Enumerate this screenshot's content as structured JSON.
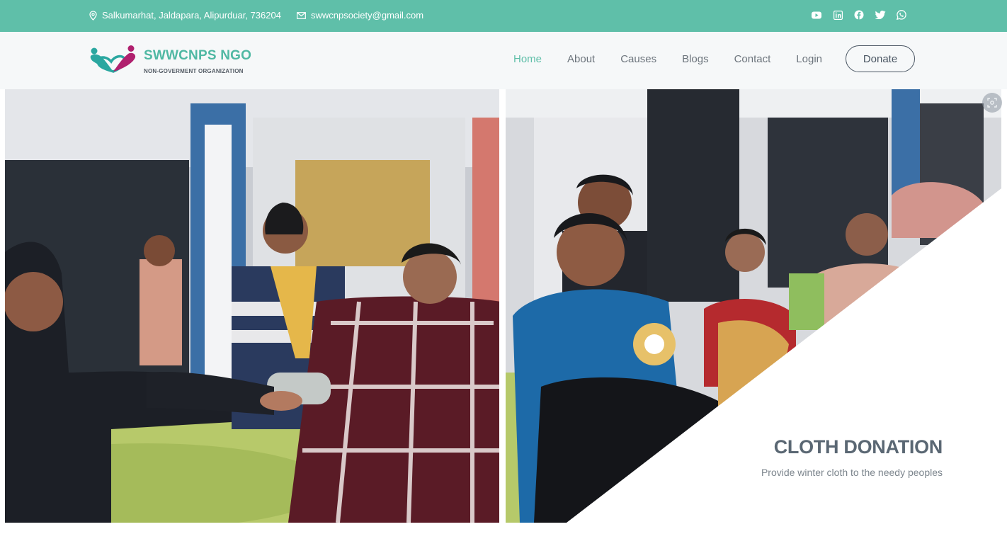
{
  "topbar": {
    "address": "Salkumarhat, Jaldapara, Alipurduar, 736204",
    "email": "swwcnpsociety@gmail.com",
    "social_icons": [
      "youtube-icon",
      "linkedin-icon",
      "facebook-icon",
      "twitter-icon",
      "whatsapp-icon"
    ]
  },
  "header": {
    "brand": "SWWCNPS NGO",
    "tagline": "NON-GOVERMENT ORGANIZATION",
    "nav": {
      "home": "Home",
      "about": "About",
      "causes": "Causes",
      "blogs": "Blogs",
      "contact": "Contact",
      "login": "Login",
      "donate": "Donate"
    }
  },
  "hero": {
    "title": "CLOTH DONATION",
    "subtitle": "Provide winter cloth to the needy peoples"
  },
  "colors": {
    "accent": "#5fbfa9",
    "heading": "#5a6773",
    "nav_text": "#6c747c"
  }
}
